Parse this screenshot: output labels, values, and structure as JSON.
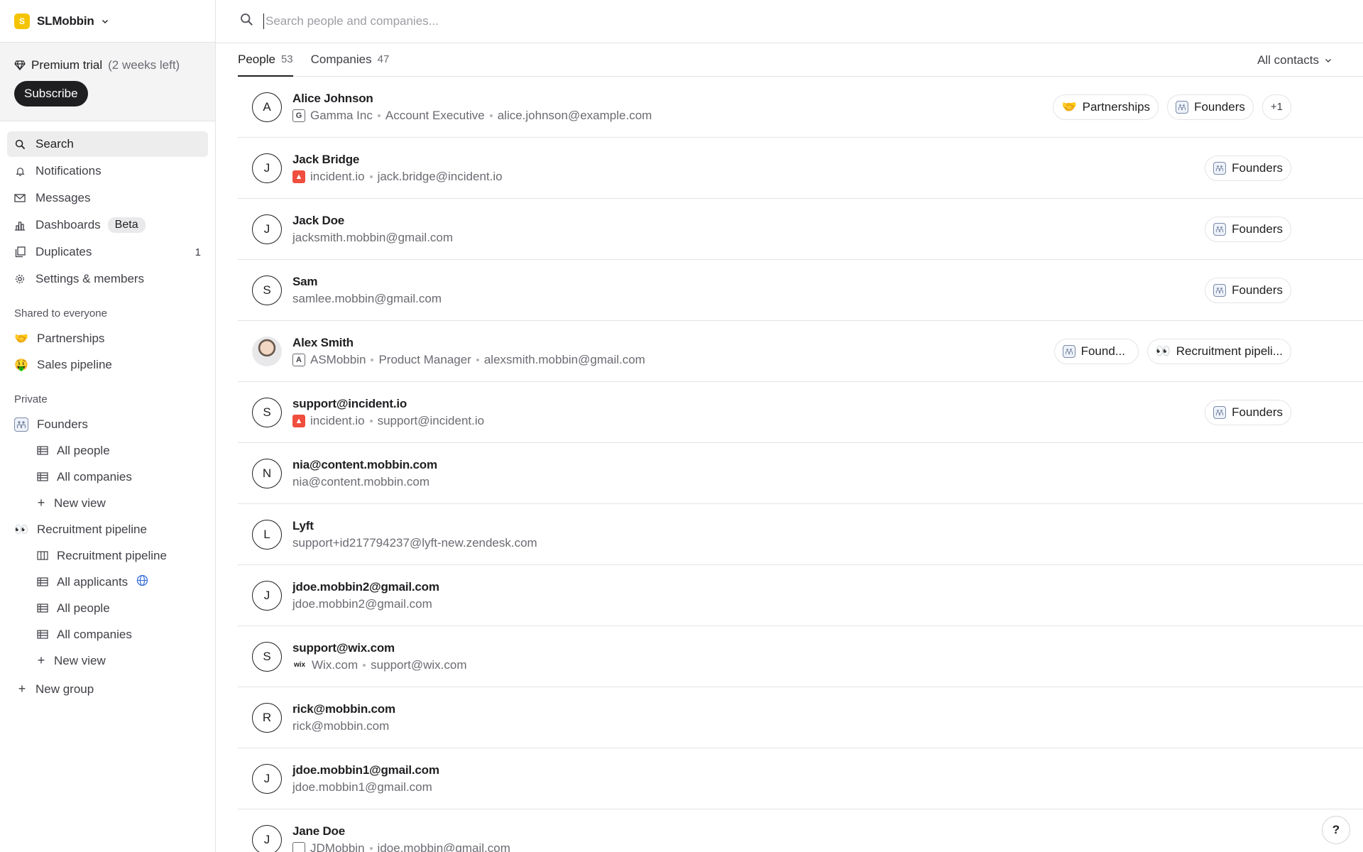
{
  "workspace": {
    "name": "SLMobbin",
    "logo_letter": "S"
  },
  "trial": {
    "label": "Premium trial",
    "remaining": "(2 weeks left)",
    "subscribe_label": "Subscribe"
  },
  "nav": {
    "search": "Search",
    "notifications": "Notifications",
    "messages": "Messages",
    "dashboards": "Dashboards",
    "dashboards_badge": "Beta",
    "duplicates": "Duplicates",
    "duplicates_count": "1",
    "settings": "Settings & members"
  },
  "shared": {
    "label": "Shared to everyone",
    "items": [
      {
        "emoji": "🤝",
        "label": "Partnerships"
      },
      {
        "emoji": "🤑",
        "label": "Sales pipeline"
      }
    ]
  },
  "private": {
    "label": "Private",
    "founders": {
      "label": "Founders",
      "views": [
        "All people",
        "All companies"
      ],
      "new_view": "New view"
    },
    "recruitment": {
      "emoji": "👀",
      "label": "Recruitment pipeline",
      "views": [
        "Recruitment pipeline",
        "All applicants",
        "All people",
        "All companies"
      ],
      "new_view": "New view"
    },
    "new_group": "New group"
  },
  "search": {
    "placeholder": "Search people and companies..."
  },
  "tabs": [
    {
      "label": "People",
      "count": "53"
    },
    {
      "label": "Companies",
      "count": "47"
    }
  ],
  "filter": {
    "label": "All contacts"
  },
  "rows": [
    {
      "initial": "A",
      "name": "Alice Johnson",
      "company_icon": "G",
      "company": "Gamma Inc",
      "title": "Account Executive",
      "email": "alice.johnson@example.com",
      "tags": [
        "Partnerships",
        "Founders"
      ],
      "more": "+1"
    },
    {
      "initial": "J",
      "name": "Jack Bridge",
      "company": "incident.io",
      "email": "jack.bridge@incident.io",
      "tags": [
        "Founders"
      ]
    },
    {
      "initial": "J",
      "name": "Jack Doe",
      "email": "jacksmith.mobbin@gmail.com",
      "tags": [
        "Founders"
      ]
    },
    {
      "initial": "S",
      "name": "Sam",
      "email": "samlee.mobbin@gmail.com",
      "tags": [
        "Founders"
      ]
    },
    {
      "initial": "",
      "name": "Alex Smith",
      "company_icon": "A",
      "company": "ASMobbin",
      "title": "Product Manager",
      "email": "alexsmith.mobbin@gmail.com",
      "tags": [
        "Found...",
        "Recruitment pipeli..."
      ]
    },
    {
      "initial": "S",
      "name": "support@incident.io",
      "company": "incident.io",
      "email": "support@incident.io",
      "tags": [
        "Founders"
      ]
    },
    {
      "initial": "N",
      "name": "nia@content.mobbin.com",
      "email": "nia@content.mobbin.com"
    },
    {
      "initial": "L",
      "name": "Lyft",
      "email": "support+id217794237@lyft-new.zendesk.com"
    },
    {
      "initial": "J",
      "name": "jdoe.mobbin2@gmail.com",
      "email": "jdoe.mobbin2@gmail.com"
    },
    {
      "initial": "S",
      "name": "support@wix.com",
      "company_icon": "wix",
      "company": "Wix.com",
      "email": "support@wix.com"
    },
    {
      "initial": "R",
      "name": "rick@mobbin.com",
      "email": "rick@mobbin.com"
    },
    {
      "initial": "J",
      "name": "jdoe.mobbin1@gmail.com",
      "email": "jdoe.mobbin1@gmail.com"
    },
    {
      "initial": "J",
      "name": "Jane Doe",
      "company": "JDMobbin",
      "email": "jdoe.mobbin@gmail.com"
    }
  ],
  "help": {
    "label": "?"
  }
}
